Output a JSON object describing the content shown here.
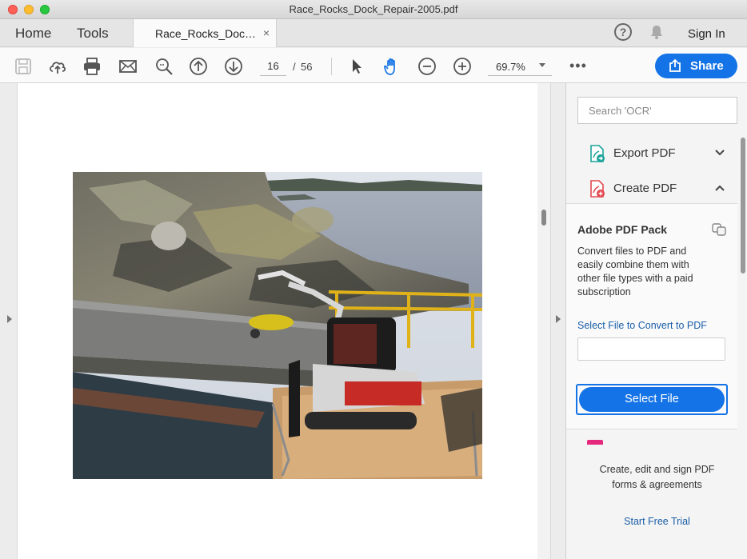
{
  "window": {
    "title": "Race_Rocks_Dock_Repair-2005.pdf"
  },
  "tabs": {
    "home": "Home",
    "tools": "Tools",
    "document": "Race_Rocks_Doc…",
    "close_glyph": "×"
  },
  "header": {
    "help_glyph": "?",
    "sign_in": "Sign In"
  },
  "toolbar": {
    "icons": [
      "save-icon",
      "upload-cloud-icon",
      "print-icon",
      "email-icon",
      "zoom-search-icon",
      "page-up-icon",
      "page-down-icon",
      "select-arrow-icon",
      "hand-tool-icon",
      "zoom-out-icon",
      "zoom-in-icon"
    ],
    "current_page": "16",
    "page_separator": "/",
    "total_pages": "56",
    "zoom": "69.7%",
    "more_glyph": "•••",
    "share_label": "Share"
  },
  "right_pane": {
    "search_placeholder": "Search 'OCR'",
    "tools": [
      {
        "label": "Export PDF",
        "icon": "export-pdf-icon",
        "expanded": false
      },
      {
        "label": "Create PDF",
        "icon": "create-pdf-icon",
        "expanded": true
      }
    ],
    "pack": {
      "title": "Adobe PDF Pack",
      "description": "Convert files to PDF and easily combine them with other file types with a paid subscription",
      "link": "Select File to Convert to PDF",
      "button": "Select File"
    },
    "promo": {
      "text_line1": "Create, edit and sign PDF",
      "text_line2": "forms & agreements",
      "link": "Start Free Trial"
    }
  },
  "colors": {
    "accent": "#1473e6",
    "link": "#1a5ea8",
    "pink": "#e4287c",
    "teal": "#1aa39a",
    "red": "#e34850"
  }
}
